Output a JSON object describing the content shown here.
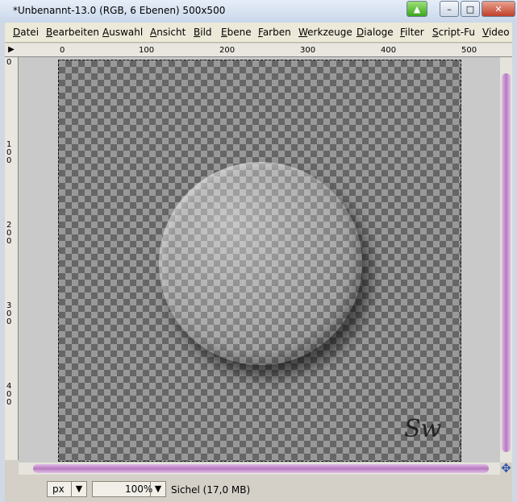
{
  "window": {
    "title": "*Unbenannt-13.0 (RGB, 6 Ebenen) 500x500",
    "buttons": {
      "minimize": "–",
      "maximize": "□",
      "close": "✕"
    }
  },
  "menu": [
    "Datei",
    "Bearbeiten",
    "Auswahl",
    "Ansicht",
    "Bild",
    "Ebene",
    "Farben",
    "Werkzeuge",
    "Dialoge",
    "Filter",
    "Script-Fu",
    "Video"
  ],
  "ruler_top": [
    "0",
    "100",
    "200",
    "300",
    "400",
    "500"
  ],
  "ruler_left": [
    "0",
    "100",
    "200",
    "300",
    "400"
  ],
  "canvas": {
    "signature": "Sw"
  },
  "statusbar": {
    "unit": "px",
    "zoom": "100%",
    "info": "Sichel (17,0 MB)"
  },
  "colors": {
    "scroll_thumb": "#b57abf",
    "checker_dark": "#666666",
    "checker_light": "#999999"
  }
}
